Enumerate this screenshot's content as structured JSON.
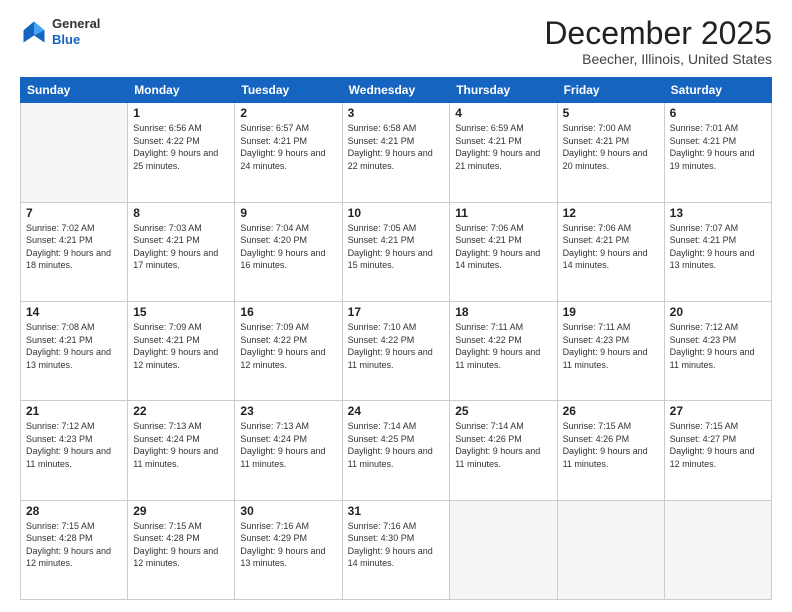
{
  "header": {
    "logo": {
      "line1": "General",
      "line2": "Blue"
    },
    "title": "December 2025",
    "subtitle": "Beecher, Illinois, United States"
  },
  "calendar": {
    "days_of_week": [
      "Sunday",
      "Monday",
      "Tuesday",
      "Wednesday",
      "Thursday",
      "Friday",
      "Saturday"
    ],
    "weeks": [
      [
        {
          "day": "",
          "sunrise": "",
          "sunset": "",
          "daylight": "",
          "empty": true
        },
        {
          "day": "1",
          "sunrise": "Sunrise: 6:56 AM",
          "sunset": "Sunset: 4:22 PM",
          "daylight": "Daylight: 9 hours and 25 minutes."
        },
        {
          "day": "2",
          "sunrise": "Sunrise: 6:57 AM",
          "sunset": "Sunset: 4:21 PM",
          "daylight": "Daylight: 9 hours and 24 minutes."
        },
        {
          "day": "3",
          "sunrise": "Sunrise: 6:58 AM",
          "sunset": "Sunset: 4:21 PM",
          "daylight": "Daylight: 9 hours and 22 minutes."
        },
        {
          "day": "4",
          "sunrise": "Sunrise: 6:59 AM",
          "sunset": "Sunset: 4:21 PM",
          "daylight": "Daylight: 9 hours and 21 minutes."
        },
        {
          "day": "5",
          "sunrise": "Sunrise: 7:00 AM",
          "sunset": "Sunset: 4:21 PM",
          "daylight": "Daylight: 9 hours and 20 minutes."
        },
        {
          "day": "6",
          "sunrise": "Sunrise: 7:01 AM",
          "sunset": "Sunset: 4:21 PM",
          "daylight": "Daylight: 9 hours and 19 minutes."
        }
      ],
      [
        {
          "day": "7",
          "sunrise": "Sunrise: 7:02 AM",
          "sunset": "Sunset: 4:21 PM",
          "daylight": "Daylight: 9 hours and 18 minutes."
        },
        {
          "day": "8",
          "sunrise": "Sunrise: 7:03 AM",
          "sunset": "Sunset: 4:21 PM",
          "daylight": "Daylight: 9 hours and 17 minutes."
        },
        {
          "day": "9",
          "sunrise": "Sunrise: 7:04 AM",
          "sunset": "Sunset: 4:20 PM",
          "daylight": "Daylight: 9 hours and 16 minutes."
        },
        {
          "day": "10",
          "sunrise": "Sunrise: 7:05 AM",
          "sunset": "Sunset: 4:21 PM",
          "daylight": "Daylight: 9 hours and 15 minutes."
        },
        {
          "day": "11",
          "sunrise": "Sunrise: 7:06 AM",
          "sunset": "Sunset: 4:21 PM",
          "daylight": "Daylight: 9 hours and 14 minutes."
        },
        {
          "day": "12",
          "sunrise": "Sunrise: 7:06 AM",
          "sunset": "Sunset: 4:21 PM",
          "daylight": "Daylight: 9 hours and 14 minutes."
        },
        {
          "day": "13",
          "sunrise": "Sunrise: 7:07 AM",
          "sunset": "Sunset: 4:21 PM",
          "daylight": "Daylight: 9 hours and 13 minutes."
        }
      ],
      [
        {
          "day": "14",
          "sunrise": "Sunrise: 7:08 AM",
          "sunset": "Sunset: 4:21 PM",
          "daylight": "Daylight: 9 hours and 13 minutes."
        },
        {
          "day": "15",
          "sunrise": "Sunrise: 7:09 AM",
          "sunset": "Sunset: 4:21 PM",
          "daylight": "Daylight: 9 hours and 12 minutes."
        },
        {
          "day": "16",
          "sunrise": "Sunrise: 7:09 AM",
          "sunset": "Sunset: 4:22 PM",
          "daylight": "Daylight: 9 hours and 12 minutes."
        },
        {
          "day": "17",
          "sunrise": "Sunrise: 7:10 AM",
          "sunset": "Sunset: 4:22 PM",
          "daylight": "Daylight: 9 hours and 11 minutes."
        },
        {
          "day": "18",
          "sunrise": "Sunrise: 7:11 AM",
          "sunset": "Sunset: 4:22 PM",
          "daylight": "Daylight: 9 hours and 11 minutes."
        },
        {
          "day": "19",
          "sunrise": "Sunrise: 7:11 AM",
          "sunset": "Sunset: 4:23 PM",
          "daylight": "Daylight: 9 hours and 11 minutes."
        },
        {
          "day": "20",
          "sunrise": "Sunrise: 7:12 AM",
          "sunset": "Sunset: 4:23 PM",
          "daylight": "Daylight: 9 hours and 11 minutes."
        }
      ],
      [
        {
          "day": "21",
          "sunrise": "Sunrise: 7:12 AM",
          "sunset": "Sunset: 4:23 PM",
          "daylight": "Daylight: 9 hours and 11 minutes."
        },
        {
          "day": "22",
          "sunrise": "Sunrise: 7:13 AM",
          "sunset": "Sunset: 4:24 PM",
          "daylight": "Daylight: 9 hours and 11 minutes."
        },
        {
          "day": "23",
          "sunrise": "Sunrise: 7:13 AM",
          "sunset": "Sunset: 4:24 PM",
          "daylight": "Daylight: 9 hours and 11 minutes."
        },
        {
          "day": "24",
          "sunrise": "Sunrise: 7:14 AM",
          "sunset": "Sunset: 4:25 PM",
          "daylight": "Daylight: 9 hours and 11 minutes."
        },
        {
          "day": "25",
          "sunrise": "Sunrise: 7:14 AM",
          "sunset": "Sunset: 4:26 PM",
          "daylight": "Daylight: 9 hours and 11 minutes."
        },
        {
          "day": "26",
          "sunrise": "Sunrise: 7:15 AM",
          "sunset": "Sunset: 4:26 PM",
          "daylight": "Daylight: 9 hours and 11 minutes."
        },
        {
          "day": "27",
          "sunrise": "Sunrise: 7:15 AM",
          "sunset": "Sunset: 4:27 PM",
          "daylight": "Daylight: 9 hours and 12 minutes."
        }
      ],
      [
        {
          "day": "28",
          "sunrise": "Sunrise: 7:15 AM",
          "sunset": "Sunset: 4:28 PM",
          "daylight": "Daylight: 9 hours and 12 minutes."
        },
        {
          "day": "29",
          "sunrise": "Sunrise: 7:15 AM",
          "sunset": "Sunset: 4:28 PM",
          "daylight": "Daylight: 9 hours and 12 minutes."
        },
        {
          "day": "30",
          "sunrise": "Sunrise: 7:16 AM",
          "sunset": "Sunset: 4:29 PM",
          "daylight": "Daylight: 9 hours and 13 minutes."
        },
        {
          "day": "31",
          "sunrise": "Sunrise: 7:16 AM",
          "sunset": "Sunset: 4:30 PM",
          "daylight": "Daylight: 9 hours and 14 minutes."
        },
        {
          "day": "",
          "sunrise": "",
          "sunset": "",
          "daylight": "",
          "empty": true
        },
        {
          "day": "",
          "sunrise": "",
          "sunset": "",
          "daylight": "",
          "empty": true
        },
        {
          "day": "",
          "sunrise": "",
          "sunset": "",
          "daylight": "",
          "empty": true
        }
      ]
    ]
  }
}
